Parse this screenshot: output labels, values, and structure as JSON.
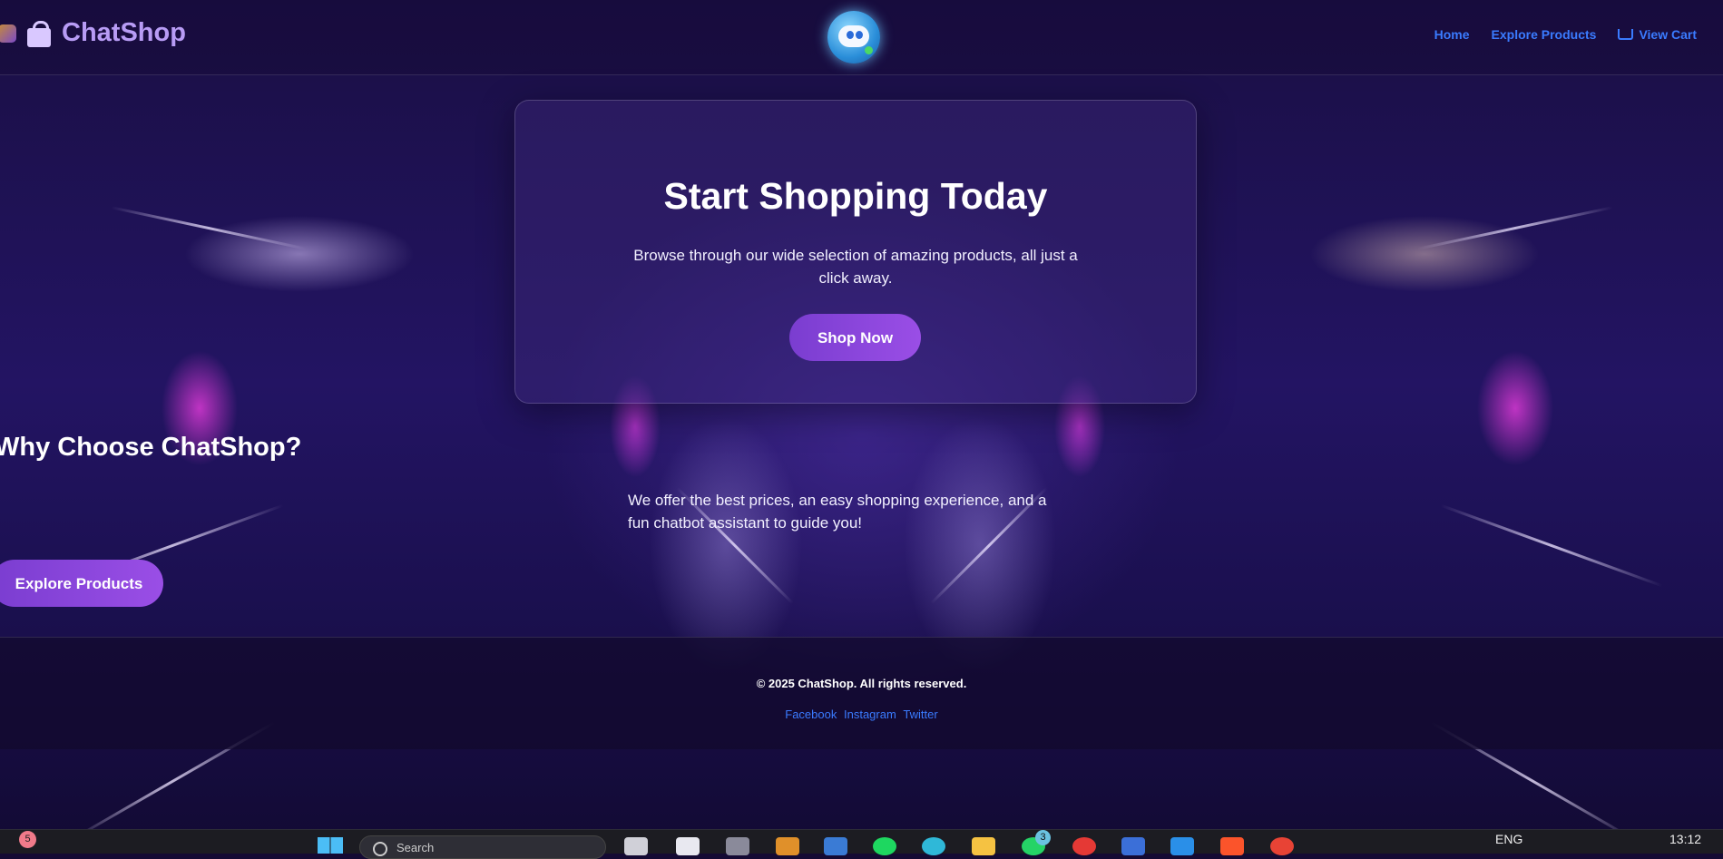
{
  "header": {
    "brand": "ChatShop",
    "nav": [
      {
        "label": "Home"
      },
      {
        "label": "Explore Products"
      },
      {
        "label": "View Cart"
      }
    ]
  },
  "hero": {
    "title": "Start Shopping Today",
    "subtitle": "Browse through our wide selection of amazing products, all just a click away.",
    "cta": "Shop Now"
  },
  "why": {
    "title": "Why Choose ChatShop?",
    "description": "We offer the best prices, an easy shopping experience, and a fun chatbot assistant to guide you!",
    "cta": "Explore Products"
  },
  "footer": {
    "copyright": "© 2025 ChatShop. All rights reserved.",
    "social": [
      "Facebook",
      "Instagram",
      "Twitter"
    ]
  },
  "taskbar": {
    "notification_count": "5",
    "search_placeholder": "Search",
    "app_badge": "3",
    "language": "ENG",
    "time": "13:12"
  },
  "colors": {
    "accent": "#8a45dc",
    "link": "#3a7bff",
    "brand": "#b89cf5",
    "background": "#1a0f44"
  },
  "icons": [
    "shopping-bag-icon",
    "chatbot-icon",
    "cart-icon",
    "windows-start-icon",
    "search-icon"
  ]
}
